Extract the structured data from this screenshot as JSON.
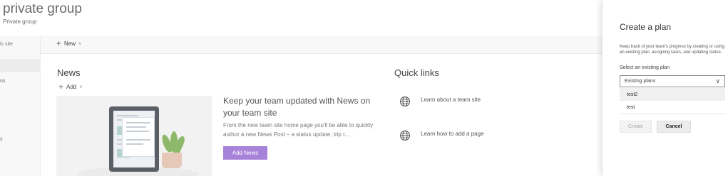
{
  "site": {
    "title": "private group",
    "subtitle": "Private group"
  },
  "leftnav": {
    "search_partial": "is site",
    "items": [
      "ns",
      "s"
    ]
  },
  "command_bar": {
    "new_label": "New"
  },
  "news": {
    "heading": "News",
    "add_label": "Add",
    "promo_title": "Keep your team updated with News on your team site",
    "promo_text": "From the new team site home page you'll be able to quickly author a new News Post – a status update, trip r...",
    "add_news_button": "Add News"
  },
  "quick_links": {
    "heading": "Quick links",
    "items": [
      {
        "label": "Learn about a team site",
        "icon": "globe-icon"
      },
      {
        "label": "Learn how to add a page",
        "icon": "globe-icon"
      }
    ]
  },
  "create_plan_panel": {
    "title": "Create a plan",
    "description": "Keep track of your team's progress by creating or using an existing plan, assigning tasks, and updating status.",
    "select_label": "Select an existing plan",
    "select_value": "Existing plans",
    "options": [
      "test2",
      "test"
    ],
    "create_button": "Create",
    "cancel_button": "Cancel"
  },
  "colors": {
    "accent": "#a682d9",
    "panel_bg": "#ffffff",
    "nav_bg": "#f8f8f8"
  }
}
